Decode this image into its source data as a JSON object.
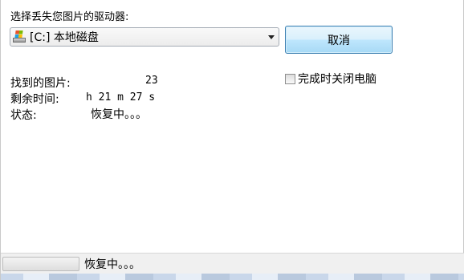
{
  "prompt": "选择丢失您图片的驱动器:",
  "drive_select": {
    "selected": "[C:] 本地磁盘",
    "icon": "windows-drive-icon"
  },
  "cancel_label": "取消",
  "shutdown_label": "完成时关闭电脑",
  "shutdown_checked": false,
  "found": {
    "label": "找到的图片:",
    "value": "23"
  },
  "remaining": {
    "label": "剩余时间:",
    "value": "h 21 m 27 s"
  },
  "state": {
    "label": "状态:",
    "value": "恢复中。。。"
  },
  "statusbar": {
    "text": "恢复中。。。",
    "progress": 0
  }
}
